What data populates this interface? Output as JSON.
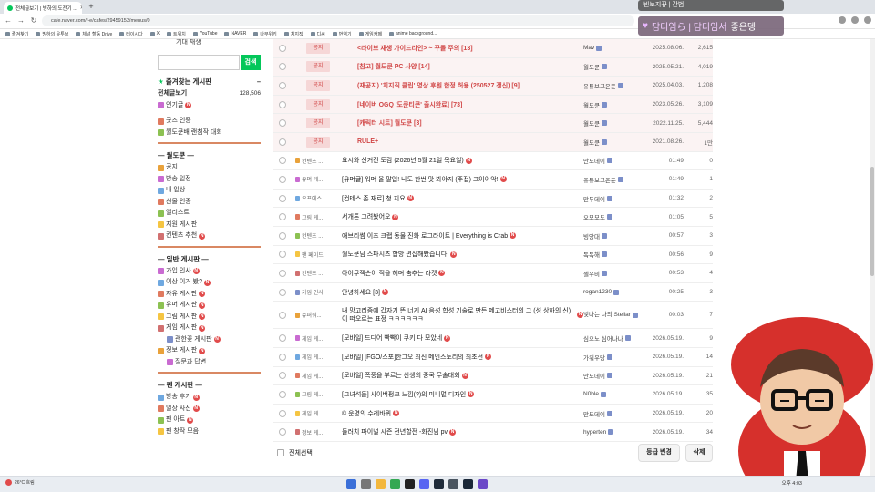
{
  "browser": {
    "tab_title": "전체글보기 | 빙하의 도전기 ...",
    "url": "cafe.naver.com/f-e/cafes/29459153/menus/0",
    "bookmarks": [
      "즐겨찾기",
      "빙하의 유투브",
      "체널 할동 Drive",
      "테이시다",
      "X",
      "트위치",
      "YouTube",
      "NAVER",
      "나무위키",
      "치지직",
      "디씨",
      "번역기",
      "게임카페",
      "anime background..."
    ]
  },
  "sidebar": {
    "top_label": "기대 재생",
    "search_button": "검색",
    "favorites": {
      "title": "즐겨찾는 게시판",
      "items": [
        {
          "label": "전체글보기",
          "count": "128,506",
          "bold": true
        },
        {
          "label": "인기글",
          "badge": "N"
        }
      ]
    },
    "extra_items": [
      {
        "label": "굿즈 인증"
      },
      {
        "label": "월도쿤배 랜침작 대회"
      }
    ],
    "groups": [
      {
        "title": "— 월도쿤 —",
        "items": [
          {
            "label": "공지"
          },
          {
            "label": "방송 일정"
          },
          {
            "label": "내 일상"
          },
          {
            "label": "선물 인증"
          },
          {
            "label": "앨리스트"
          },
          {
            "label": "지원 게시판"
          },
          {
            "label": "컨텐츠 추천",
            "badge": "N"
          }
        ]
      },
      {
        "title": "— 일반 게시판 —",
        "items": [
          {
            "label": "가입 인사",
            "badge": "N"
          },
          {
            "label": "이상 이거 봤?",
            "badge": "N"
          },
          {
            "label": "자유 게시판",
            "badge": "N"
          },
          {
            "label": "유머 게시판",
            "badge": "N"
          },
          {
            "label": "그림 게시판",
            "badge": "N"
          },
          {
            "label": "게임 게시판",
            "badge": "N"
          },
          {
            "label": "괜한꽃 게시판",
            "badge": "N",
            "sub": true
          },
          {
            "label": "정보 게시판",
            "badge": "N"
          },
          {
            "label": "질문과 답변",
            "sub": true
          }
        ]
      },
      {
        "title": "— 팬 게시판 —",
        "items": [
          {
            "label": "방송 후기",
            "badge": "N"
          },
          {
            "label": "일상 사진",
            "badge": "N"
          },
          {
            "label": "팬 아트",
            "badge": "N"
          },
          {
            "label": "팬 창작 모음"
          }
        ]
      }
    ]
  },
  "notices": [
    {
      "tag": "공지",
      "title": "<라이브 재생 가이드라인> ~ 꾸몰 주의 [13]",
      "author": "Mav",
      "date": "2025.08.06.",
      "views": "2,615"
    },
    {
      "tag": "공지",
      "title": "[참고] 월도쿤 PC 사양 [14]",
      "author": "월도쿤",
      "date": "2025.05.21.",
      "views": "4,019"
    },
    {
      "tag": "공지",
      "title": "(재공지) '치지직 클립' 영상 후원 한정 허용 (250527 갱신) [9]",
      "author": "유튜보고은둔",
      "date": "2025.04.03.",
      "views": "1,208"
    },
    {
      "tag": "공지",
      "title": "[네이버 OGQ '도쿤티콘' 출시완료] [73]",
      "author": "월도쿤",
      "date": "2023.05.26.",
      "views": "3,109"
    },
    {
      "tag": "공지",
      "title": "[캐릭터 시트] 월도쿤 [3]",
      "author": "월도쿤",
      "date": "2022.11.25.",
      "views": "5,444"
    },
    {
      "tag": "공지",
      "title": "RULE+",
      "author": "월도쿤",
      "date": "2021.08.26.",
      "views": "1만"
    }
  ],
  "posts": [
    {
      "cat": "컨텐츠 ...",
      "title": "요시와 신거진 도감 (2026년 5월 21일 목요일)",
      "author": "만도데이",
      "date": "01:49",
      "views": "0"
    },
    {
      "cat": "유머 게...",
      "title": "[유머글] 워머 올 말입! 나도 한번 맛 봐야지 (주접) 크아아악!",
      "author": "유튜보고은둔",
      "date": "01:49",
      "views": "1"
    },
    {
      "cat": "오프에스",
      "title": "[컨테스 존 재료] 청 지요",
      "author": "만두데이",
      "date": "01:32",
      "views": "2"
    },
    {
      "cat": "그림 게...",
      "title": "서개톤 그려봤어오",
      "author": "오모모도",
      "date": "01:05",
      "views": "5"
    },
    {
      "cat": "컨텐츠 ...",
      "title": "애브리썸 이즈 크랩 동물 진화 로그라이트 | Everything is Crab",
      "author": "빙앙대",
      "date": "00:57",
      "views": "3"
    },
    {
      "cat": "팬 페이드",
      "title": "월도쿤님 스파시츠 합방 편집해봤습니다.",
      "author": "독독해",
      "date": "00:56",
      "views": "9"
    },
    {
      "cat": "컨텐츠 ...",
      "title": "아이쿠젝슨이 직을 헤며 춤추는 라켓",
      "author": "젤우비",
      "date": "00:53",
      "views": "4"
    },
    {
      "cat": "가입 인사",
      "title": "안녕하세요 [3]",
      "author": "rogan1230",
      "date": "00:25",
      "views": "3"
    },
    {
      "cat": "슈퍼워...",
      "title": "내 망고리즘에 갑자기 뜬 너게 AI 음성 합성 기술로 만든 메고비스터의 그 (성 상하의 신)이 떠오르는 표정 ㅋㅋㅋㅋㅋㅋ",
      "author": "빛나는 나의 Stellar",
      "date": "00:03",
      "views": "7",
      "double": true
    },
    {
      "cat": "게임 게...",
      "title": "[모바일] 드디어 빡빡이 쿠키 다 모았네",
      "author": "심으노 심어나나",
      "date": "2026.05.19.",
      "views": "9"
    },
    {
      "cat": "게임 게...",
      "title": "[모바일] [FGO/스포]한그오 최신 메인스토리의 최초전",
      "author": "가워우당",
      "date": "2026.05.19.",
      "views": "14"
    },
    {
      "cat": "게임 게...",
      "title": "[모바일] 폭풍을 부르는 선생의 중국 무술대회",
      "author": "만도데이",
      "date": "2026.05.19.",
      "views": "21"
    },
    {
      "cat": "그림 게...",
      "title": "[그녀석들] 사이버펑크 느낌(?)의 미니멀 디자인",
      "author": "N0ble",
      "date": "2026.05.19.",
      "views": "35"
    },
    {
      "cat": "게임 게...",
      "title": "© 운명의 수레바퀴",
      "author": "만도데이",
      "date": "2026.05.19.",
      "views": "20"
    },
    {
      "cat": "정보 게...",
      "title": "들러치 파이널 시즌 전년할전 -화진님 pv",
      "author": "hyperten",
      "date": "2026.05.19.",
      "views": "34"
    }
  ],
  "footer": {
    "select_all": "전체선택",
    "grade_button": "등급 변경",
    "delete_button": "삭제"
  },
  "stream": {
    "top_chip": "빈보지뀨 | 간범",
    "donor": "담디임ら | 담디임서",
    "message": "좋은뎅"
  },
  "taskbar": {
    "weather": "26°C 흐림",
    "clock": "오후 4:03"
  }
}
